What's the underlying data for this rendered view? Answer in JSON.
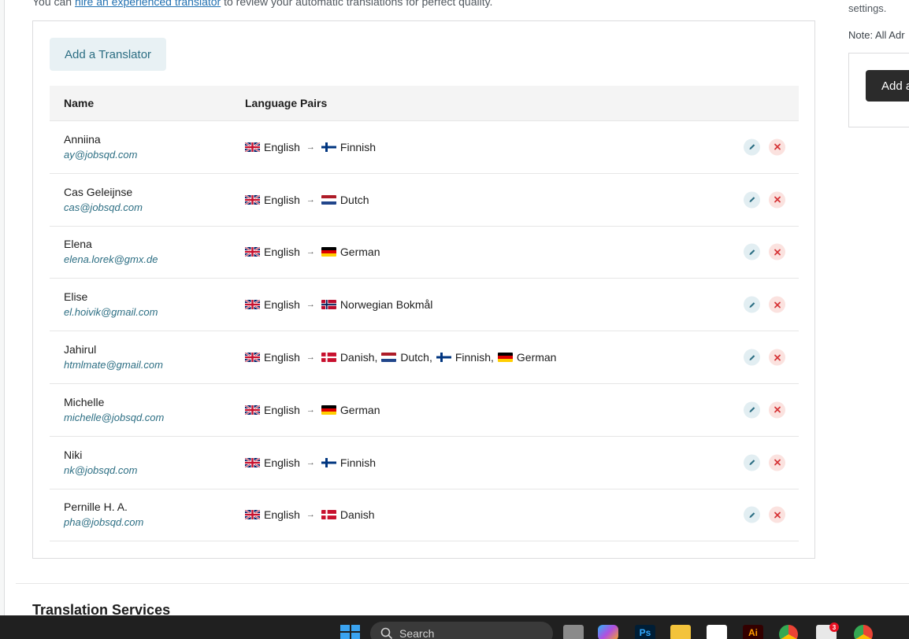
{
  "intro": {
    "prefix": "You can ",
    "link": "hire an experienced translator",
    "suffix": " to review your automatic translations for perfect quality."
  },
  "add_translator_label": "Add a Translator",
  "table": {
    "headers": {
      "name": "Name",
      "pairs": "Language Pairs"
    },
    "rows": [
      {
        "name": "Anniina",
        "email": "ay@jobsqd.com",
        "source": "English",
        "targets": [
          "Finnish"
        ]
      },
      {
        "name": "Cas Geleijnse",
        "email": "cas@jobsqd.com",
        "source": "English",
        "targets": [
          "Dutch"
        ]
      },
      {
        "name": "Elena",
        "email": "elena.lorek@gmx.de",
        "source": "English",
        "targets": [
          "German"
        ]
      },
      {
        "name": "Elise",
        "email": "el.hoivik@gmail.com",
        "source": "English",
        "targets": [
          "Norwegian Bokmål"
        ]
      },
      {
        "name": "Jahirul",
        "email": "htmlmate@gmail.com",
        "source": "English",
        "targets": [
          "Danish,",
          "Dutch,",
          "Finnish,",
          "German"
        ]
      },
      {
        "name": "Michelle",
        "email": "michelle@jobsqd.com",
        "source": "English",
        "targets": [
          "German"
        ]
      },
      {
        "name": "Niki",
        "email": "nk@jobsqd.com",
        "source": "English",
        "targets": [
          "Finnish"
        ]
      },
      {
        "name": "Pernille H. A.",
        "email": "pha@jobsqd.com",
        "source": "English",
        "targets": [
          "Danish"
        ]
      }
    ],
    "arrow": "→"
  },
  "section_title": "Translation Services",
  "sidebar": {
    "text1": "settings.",
    "text2": "Note: All Adr",
    "button": "Add a"
  },
  "taskbar": {
    "search_placeholder": "Search",
    "badge_count": "3",
    "apps": [
      "Ps",
      "Ai"
    ]
  },
  "colors": {
    "accent": "#2c6e83",
    "link": "#2271b1",
    "edit_bg": "#e2eef2",
    "delete_bg": "#fbe2df",
    "delete_icon": "#d63638"
  },
  "flags": {
    "English": "flag-uk",
    "Finnish": "flag-fi",
    "Dutch": "flag-nl",
    "German": "flag-de",
    "Norwegian Bokmål": "flag-no",
    "Danish": "flag-dk"
  }
}
